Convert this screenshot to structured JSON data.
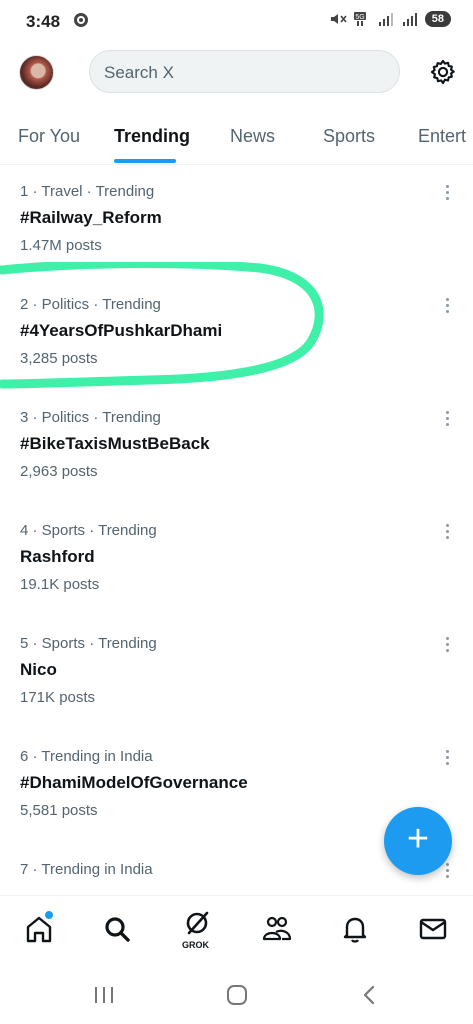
{
  "status": {
    "time": "3:48",
    "battery": "58",
    "network": "5G"
  },
  "search": {
    "placeholder": "Search X"
  },
  "tabs": [
    "For You",
    "Trending",
    "News",
    "Sports",
    "Entert"
  ],
  "trends": [
    {
      "meta": "1 · Travel · Trending",
      "name": "#Railway_Reform",
      "posts": "1.47M posts"
    },
    {
      "meta": "2 · Politics · Trending",
      "name": "#4YearsOfPushkarDhami",
      "posts": "3,285 posts"
    },
    {
      "meta": "3 · Politics · Trending",
      "name": "#BikeTaxisMustBeBack",
      "posts": "2,963 posts"
    },
    {
      "meta": "4 · Sports · Trending",
      "name": "Rashford",
      "posts": "19.1K posts"
    },
    {
      "meta": "5 · Sports · Trending",
      "name": "Nico",
      "posts": "171K posts"
    },
    {
      "meta": "6 · Trending in India",
      "name": "#DhamiModelOfGovernance",
      "posts": "5,581 posts"
    },
    {
      "meta": "7 · Trending in India",
      "name": "",
      "posts": ""
    }
  ],
  "fab": {
    "label": "+"
  },
  "nav": {
    "grok_label": "GROK"
  },
  "colors": {
    "accent": "#1d9bf0",
    "highlight": "#3ef0a8"
  }
}
